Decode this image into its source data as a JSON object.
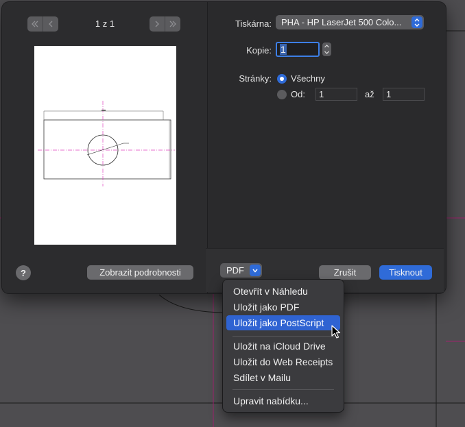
{
  "colors": {
    "accent": "#2f6bd8",
    "menu_highlight": "#2f63d2",
    "canvas_magenta": "#a0226e"
  },
  "preview": {
    "page_counter": "1 z 1",
    "nav_first_icon": "double-chevron-left-icon",
    "nav_prev_icon": "chevron-left-icon",
    "nav_next_icon": "chevron-right-icon",
    "nav_last_icon": "double-chevron-right-icon"
  },
  "settings": {
    "printer_label": "Tiskárna:",
    "printer_value": "PHA - HP LaserJet 500 Colo...",
    "copies_label": "Kopie:",
    "copies_value": "1",
    "pages_label": "Stránky:",
    "pages_all_label": "Všechny",
    "pages_from_label": "Od:",
    "pages_from_value": "1",
    "pages_to_label": "až",
    "pages_to_value": "1"
  },
  "footer": {
    "help_label": "?",
    "show_details_label": "Zobrazit podrobnosti",
    "pdf_label": "PDF",
    "cancel_label": "Zrušit",
    "print_label": "Tisknout"
  },
  "pdf_menu": {
    "items": [
      "Otevřít v Náhledu",
      "Uložit jako PDF",
      "Uložit jako PostScript",
      "Uložit na iCloud Drive",
      "Uložit do Web Receipts",
      "Sdílet v Mailu",
      "Upravit nabídku..."
    ],
    "highlighted_index": 2
  }
}
